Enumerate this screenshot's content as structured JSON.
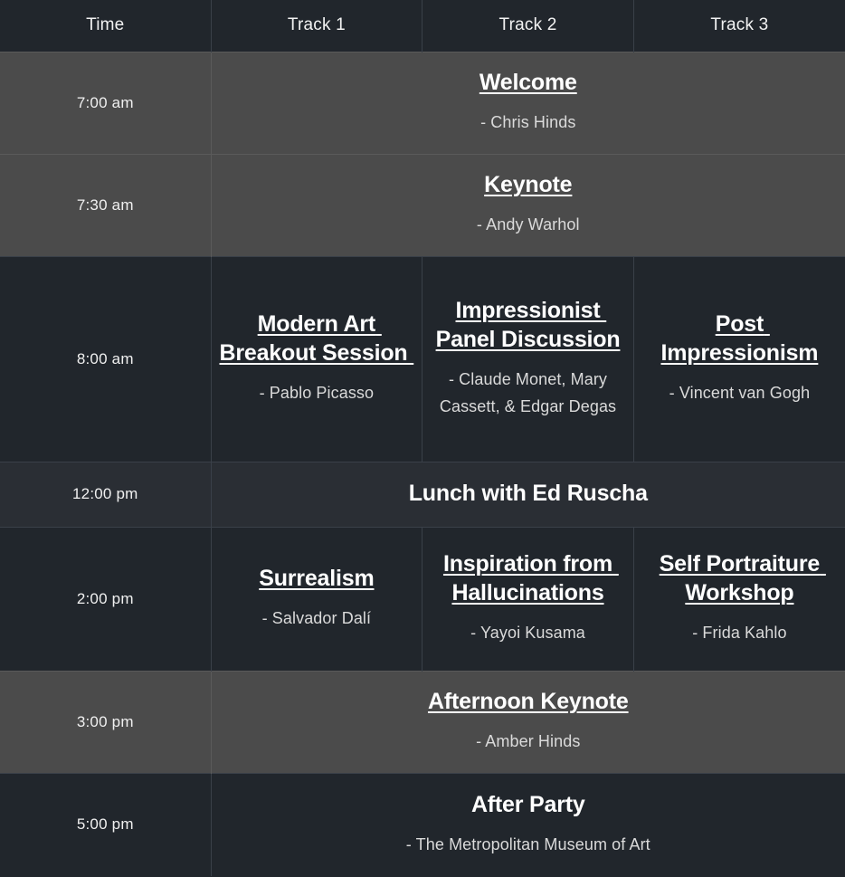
{
  "table": {
    "headers": [
      "Time",
      "Track 1",
      "Track 2",
      "Track 3"
    ],
    "colors": {
      "row_light": "#4b4b4b",
      "row_dark": "#21262c",
      "row_mid": "#2a2e34",
      "header_bg": "#21262c",
      "border": "#3a4049",
      "title_text": "#ffffff",
      "speaker_text": "#dadada"
    },
    "rows": [
      {
        "time": "7:00 am",
        "style": "light",
        "span": true,
        "session": {
          "title": "Welcome",
          "speaker": "- Chris Hinds",
          "underlined": true
        }
      },
      {
        "time": "7:30 am",
        "style": "light",
        "span": true,
        "session": {
          "title": "Keynote",
          "speaker": "- Andy Warhol",
          "underlined": true
        }
      },
      {
        "time": "8:00 am",
        "style": "dark",
        "span": false,
        "tracks": [
          {
            "title": "Modern Art Breakout Session ",
            "speaker": "- Pablo Picasso",
            "underlined": true
          },
          {
            "title": "Impressionist Panel Discussion",
            "speaker": "- Claude Monet, Mary Cassett, & Edgar Degas",
            "underlined": true
          },
          {
            "title": "Post Impressionism",
            "speaker": "- Vincent van Gogh",
            "underlined": true
          }
        ]
      },
      {
        "time": "12:00 pm",
        "style": "mid",
        "span": true,
        "session": {
          "title": "Lunch with Ed Ruscha",
          "speaker": "",
          "underlined": false
        }
      },
      {
        "time": "2:00 pm",
        "style": "dark",
        "span": false,
        "tracks": [
          {
            "title": "Surrealism",
            "speaker": "- Salvador Dalí",
            "underlined": true
          },
          {
            "title": "Inspiration from Hallucinations",
            "speaker": "- Yayoi Kusama",
            "underlined": true
          },
          {
            "title": "Self Portraiture Workshop",
            "speaker": "- Frida Kahlo",
            "underlined": true
          }
        ]
      },
      {
        "time": "3:00 pm",
        "style": "light",
        "span": true,
        "session": {
          "title": "Afternoon Keynote",
          "speaker": "- Amber Hinds",
          "underlined": true
        }
      },
      {
        "time": "5:00 pm",
        "style": "dark",
        "span": true,
        "session": {
          "title": "After Party",
          "speaker": "- The Metropolitan Museum of Art",
          "underlined": false
        }
      }
    ]
  }
}
